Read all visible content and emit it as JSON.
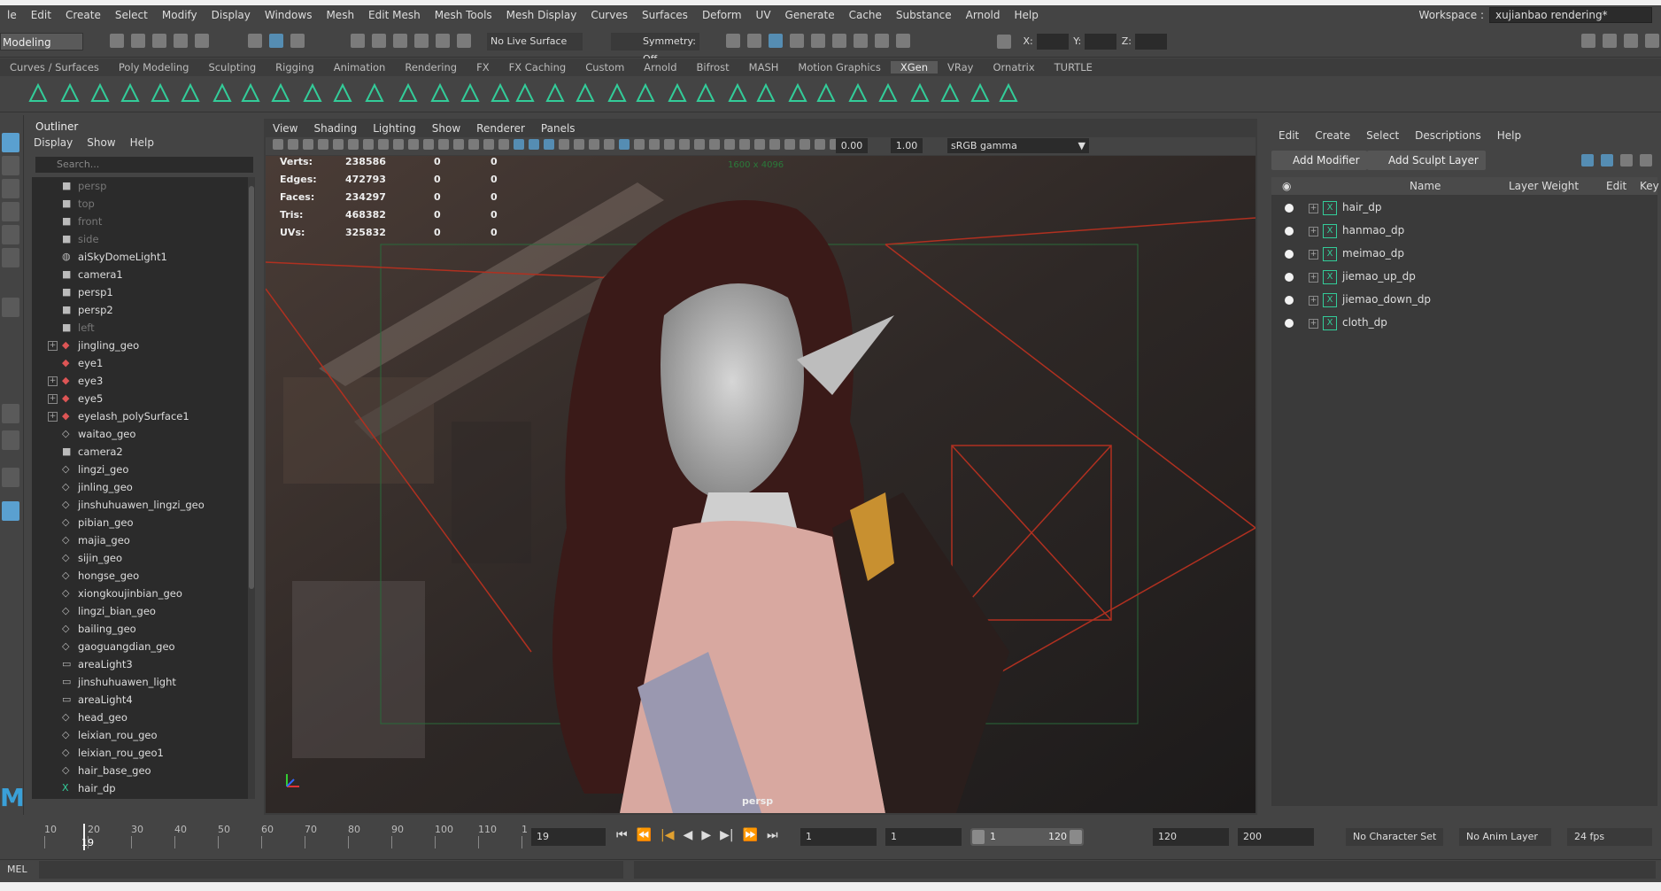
{
  "menubar": {
    "items": [
      "le",
      "Edit",
      "Create",
      "Select",
      "Modify",
      "Display",
      "Windows",
      "Mesh",
      "Edit Mesh",
      "Mesh Tools",
      "Mesh Display",
      "Curves",
      "Surfaces",
      "Deform",
      "UV",
      "Generate",
      "Cache",
      "Substance",
      "Arnold",
      "Help"
    ]
  },
  "workspace": {
    "label": "Workspace :",
    "value": "xujianbao rendering*"
  },
  "statusline": {
    "mode": "Modeling",
    "live_surface": "No Live Surface",
    "symmetry": "Symmetry: Off",
    "x_label": "X:",
    "y_label": "Y:",
    "z_label": "Z:"
  },
  "shelf_tabs": [
    "Curves / Surfaces",
    "Poly Modeling",
    "Sculpting",
    "Rigging",
    "Animation",
    "Rendering",
    "FX",
    "FX Caching",
    "Custom",
    "Arnold",
    "Bifrost",
    "MASH",
    "Motion Graphics",
    "XGen",
    "VRay",
    "Ornatrix",
    "TURTLE"
  ],
  "shelf_active_tab": "XGen",
  "outliner": {
    "title": "Outliner",
    "menu": [
      "Display",
      "Show",
      "Help"
    ],
    "search_placeholder": "Search...",
    "items": [
      {
        "label": "persp",
        "icon": "camera-icon",
        "dim": true
      },
      {
        "label": "top",
        "icon": "camera-icon",
        "dim": true
      },
      {
        "label": "front",
        "icon": "camera-icon",
        "dim": true
      },
      {
        "label": "side",
        "icon": "camera-icon",
        "dim": true
      },
      {
        "label": "aiSkyDomeLight1",
        "icon": "skydome-icon",
        "dim": false
      },
      {
        "label": "camera1",
        "icon": "camera-icon",
        "dim": false
      },
      {
        "label": "persp1",
        "icon": "camera-icon",
        "dim": false
      },
      {
        "label": "persp2",
        "icon": "camera-icon",
        "dim": false
      },
      {
        "label": "left",
        "icon": "camera-icon",
        "dim": true
      },
      {
        "label": "jingling_geo",
        "icon": "group-icon",
        "dim": false,
        "expand": true
      },
      {
        "label": "eye1",
        "icon": "group-icon",
        "dim": false
      },
      {
        "label": "eye3",
        "icon": "group-icon",
        "dim": false,
        "expand": true
      },
      {
        "label": "eye5",
        "icon": "group-icon",
        "dim": false,
        "expand": true
      },
      {
        "label": "eyelash_polySurface1",
        "icon": "group-icon",
        "dim": false,
        "expand": true
      },
      {
        "label": "waitao_geo",
        "icon": "mesh-icon",
        "dim": false
      },
      {
        "label": "camera2",
        "icon": "camera-icon",
        "dim": false
      },
      {
        "label": "lingzi_geo",
        "icon": "mesh-icon",
        "dim": false
      },
      {
        "label": "jinling_geo",
        "icon": "mesh-icon",
        "dim": false
      },
      {
        "label": "jinshuhuawen_lingzi_geo",
        "icon": "mesh-icon",
        "dim": false
      },
      {
        "label": "pibian_geo",
        "icon": "mesh-icon",
        "dim": false
      },
      {
        "label": "majia_geo",
        "icon": "mesh-icon",
        "dim": false
      },
      {
        "label": "sijin_geo",
        "icon": "mesh-icon",
        "dim": false
      },
      {
        "label": "hongse_geo",
        "icon": "mesh-icon",
        "dim": false
      },
      {
        "label": "xiongkoujinbian_geo",
        "icon": "mesh-icon",
        "dim": false
      },
      {
        "label": "lingzi_bian_geo",
        "icon": "mesh-icon",
        "dim": false
      },
      {
        "label": "bailing_geo",
        "icon": "mesh-icon",
        "dim": false
      },
      {
        "label": "gaoguangdian_geo",
        "icon": "mesh-icon",
        "dim": false
      },
      {
        "label": "areaLight3",
        "icon": "arealight-icon",
        "dim": false
      },
      {
        "label": "jinshuhuawen_light",
        "icon": "arealight-icon",
        "dim": false
      },
      {
        "label": "areaLight4",
        "icon": "arealight-icon",
        "dim": false
      },
      {
        "label": "head_geo",
        "icon": "mesh-icon",
        "dim": false
      },
      {
        "label": "leixian_rou_geo",
        "icon": "mesh-icon",
        "dim": false
      },
      {
        "label": "leixian_rou_geo1",
        "icon": "mesh-icon",
        "dim": false
      },
      {
        "label": "hair_base_geo",
        "icon": "mesh-icon",
        "dim": false
      },
      {
        "label": "hair_dp",
        "icon": "xgen-icon",
        "dim": false
      }
    ]
  },
  "viewport": {
    "menu": [
      "View",
      "Shading",
      "Lighting",
      "Show",
      "Renderer",
      "Panels"
    ],
    "exposure": "0.00",
    "gamma_value": "1.00",
    "color_space": "sRGB gamma",
    "resolution_gate": "1600 x 4096",
    "camera": "persp",
    "hud": [
      {
        "k": "Verts:",
        "a": "238586",
        "b": "0",
        "c": "0"
      },
      {
        "k": "Edges:",
        "a": "472793",
        "b": "0",
        "c": "0"
      },
      {
        "k": "Faces:",
        "a": "234297",
        "b": "0",
        "c": "0"
      },
      {
        "k": "Tris:",
        "a": "468382",
        "b": "0",
        "c": "0"
      },
      {
        "k": "UVs:",
        "a": "325832",
        "b": "0",
        "c": "0"
      }
    ]
  },
  "xgen_panel": {
    "menu": [
      "Edit",
      "Create",
      "Select",
      "Descriptions",
      "Help"
    ],
    "add_modifier": "Add Modifier",
    "add_sculpt_layer": "Add Sculpt Layer",
    "columns": [
      "Name",
      "Layer Weight",
      "Edit",
      "Key"
    ],
    "layers": [
      "hair_dp",
      "hanmao_dp",
      "meimao_dp",
      "jiemao_up_dp",
      "jiemao_down_dp",
      "cloth_dp"
    ]
  },
  "timeline": {
    "ticks": [
      "10",
      "20",
      "30",
      "40",
      "50",
      "60",
      "70",
      "80",
      "90",
      "100",
      "110",
      "1"
    ],
    "current_frame": "19",
    "frame_field": "19",
    "range_start": "1",
    "range_start_inner": "1",
    "slider_start": "1",
    "slider_end": "120",
    "range_end_inner": "120",
    "range_end": "200",
    "character_set": "No Character Set",
    "anim_layer": "No Anim Layer",
    "fps": "24 fps"
  },
  "command_line": {
    "label": "MEL"
  },
  "colors": {
    "accent": "#5aa0d0",
    "xgen_green": "#33cc99",
    "bg": "#444444"
  }
}
